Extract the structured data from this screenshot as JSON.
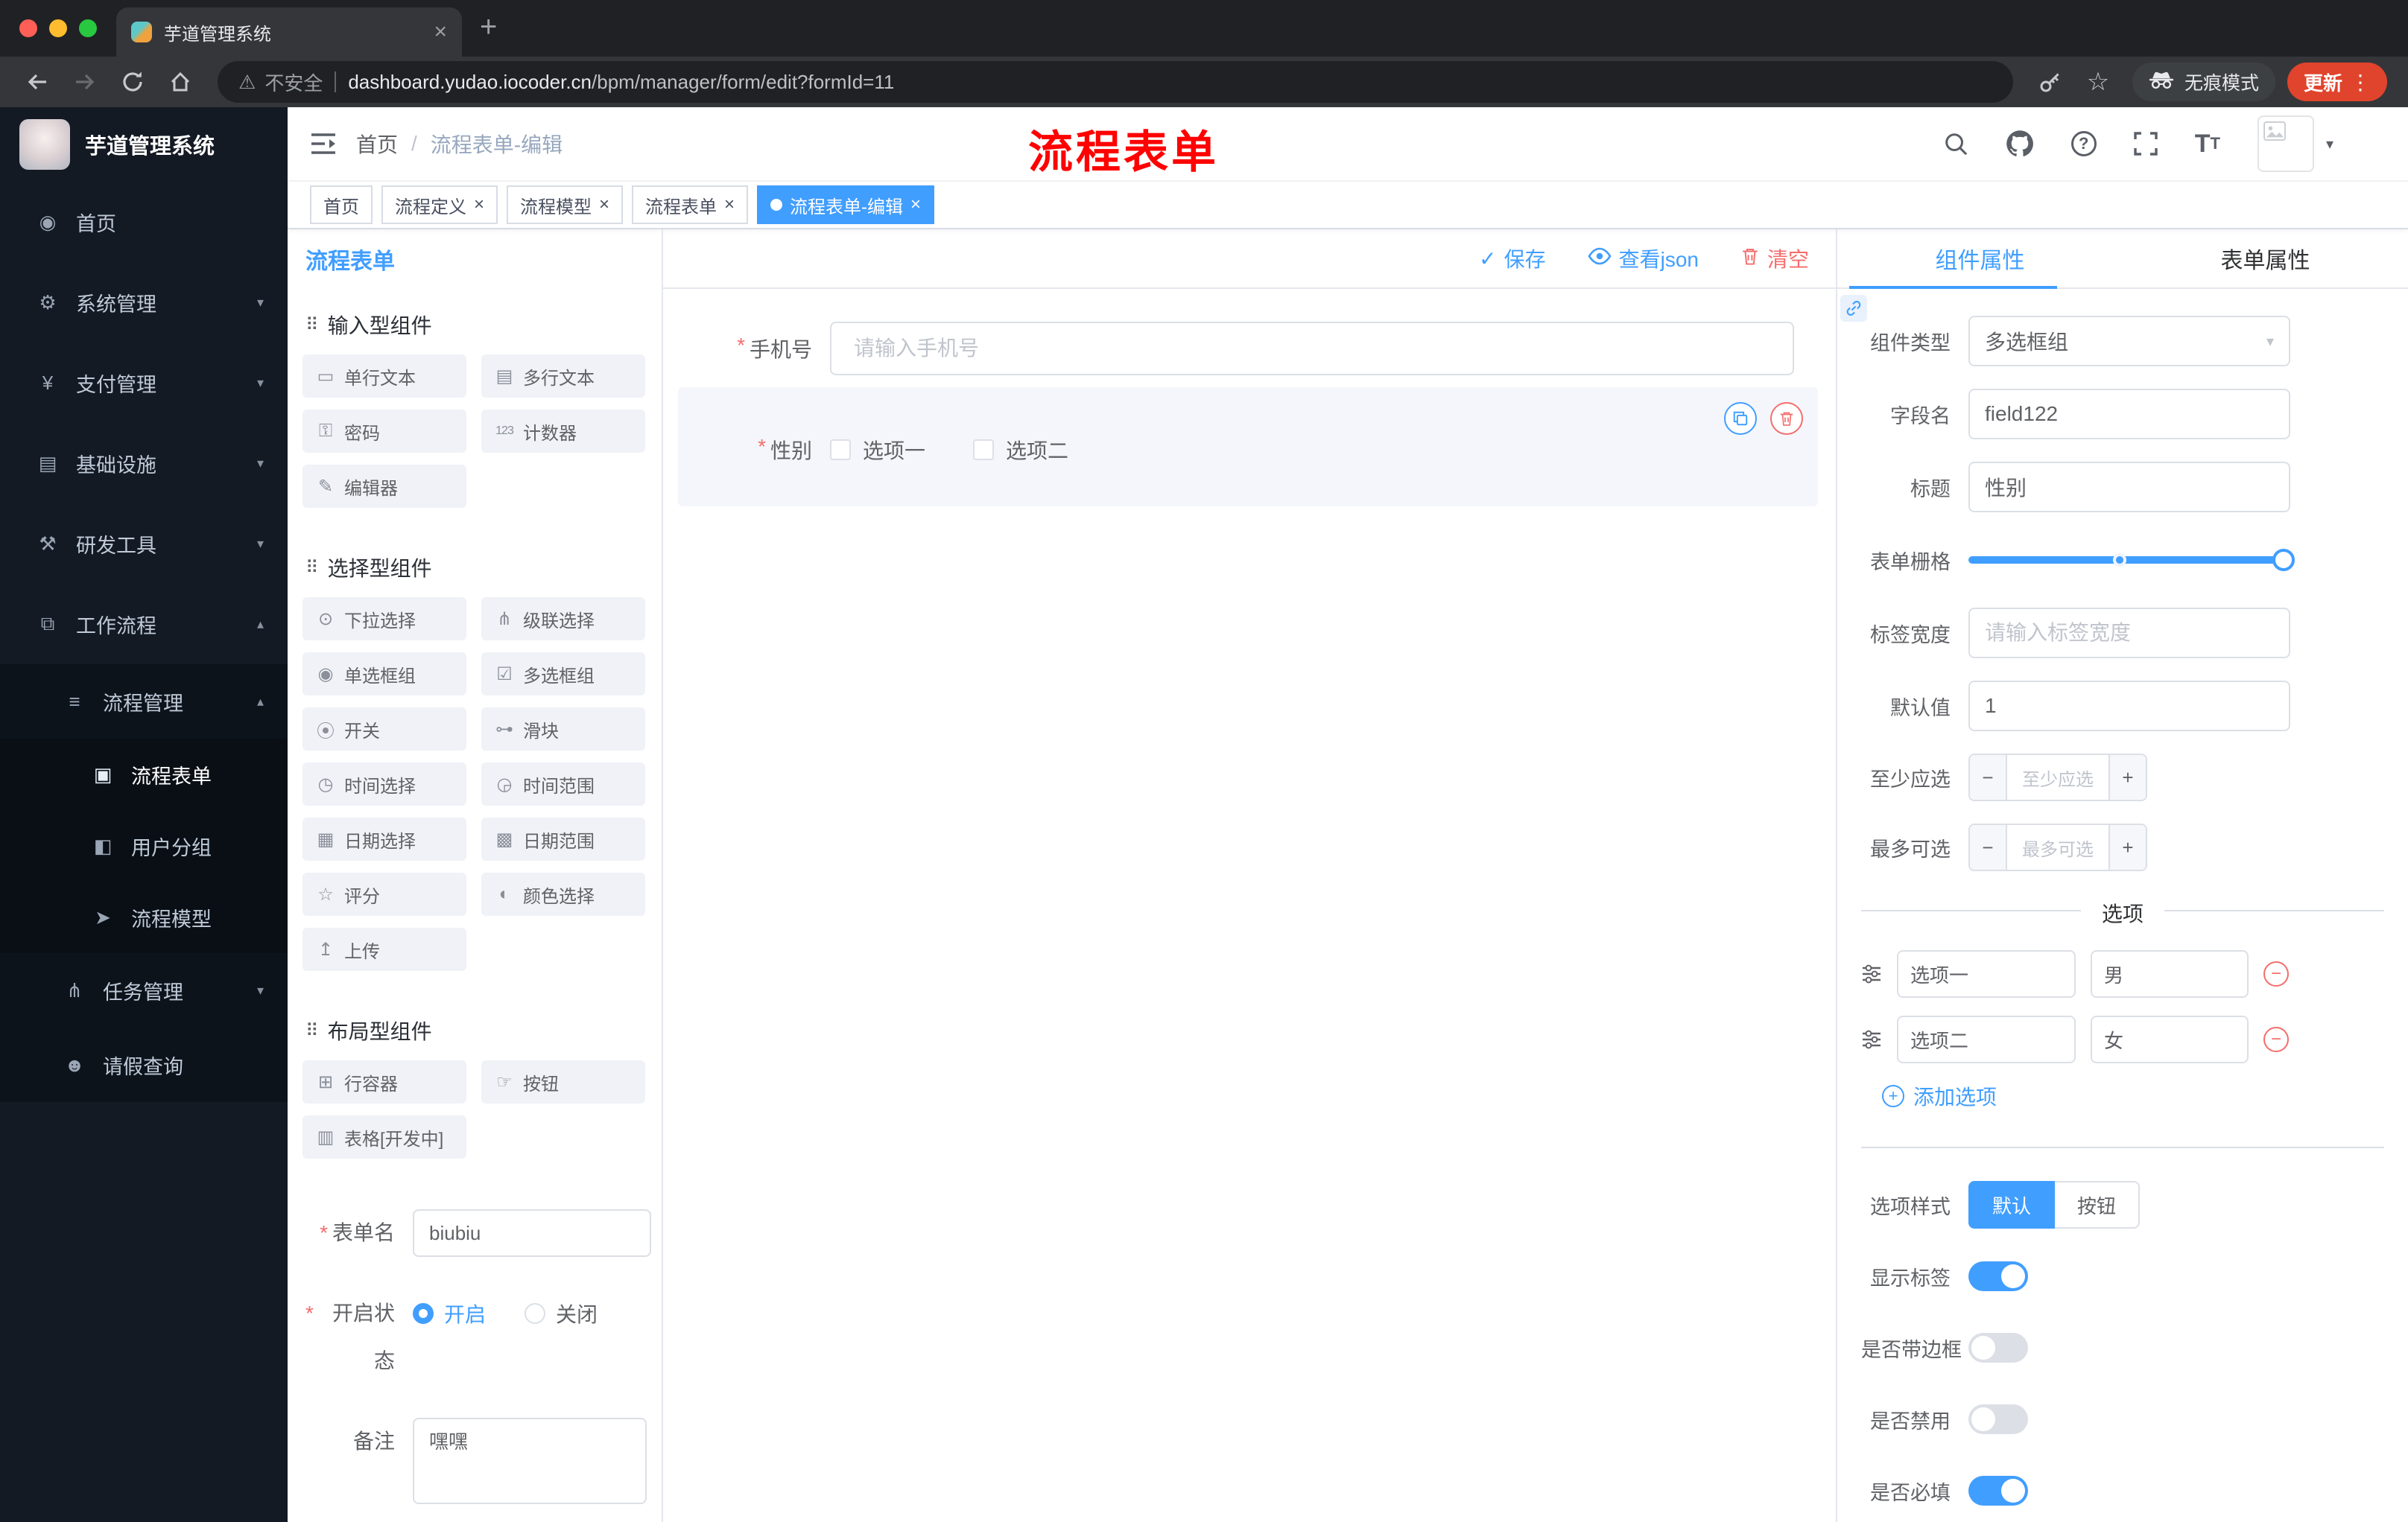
{
  "colors": {
    "accent": "#409eff",
    "danger": "#f56c6c",
    "annotation_red": "#fe0100",
    "sidebar_bg": "#141a23",
    "active_tag": "#409eff"
  },
  "browser": {
    "tab_title": "芋道管理系统",
    "security_label": "不安全",
    "url_host": "dashboard.yudao.iocoder.cn",
    "url_path": "/bpm/manager/form/edit?formId=11",
    "incognito_label": "无痕模式",
    "update_label": "更新"
  },
  "sidebar": {
    "brand": "芋道管理系统",
    "items": [
      "首页",
      "系统管理",
      "支付管理",
      "基础设施",
      "研发工具",
      "工作流程",
      "流程管理",
      "流程表单",
      "用户分组",
      "流程模型",
      "任务管理",
      "请假查询"
    ]
  },
  "navbar": {
    "breadcrumb_home": "首页",
    "breadcrumb_sep": "/",
    "breadcrumb_current": "流程表单-编辑",
    "annotation": "流程表单"
  },
  "tags": {
    "items": [
      "首页",
      "流程定义",
      "流程模型",
      "流程表单",
      "流程表单-编辑"
    ]
  },
  "palette": {
    "title": "流程表单",
    "groups": [
      {
        "title": "输入型组件",
        "items": [
          "单行文本",
          "多行文本",
          "密码",
          "计数器",
          "编辑器"
        ]
      },
      {
        "title": "选择型组件",
        "items": [
          "下拉选择",
          "级联选择",
          "单选框组",
          "多选框组",
          "开关",
          "滑块",
          "时间选择",
          "时间范围",
          "日期选择",
          "日期范围",
          "评分",
          "颜色选择",
          "上传"
        ]
      },
      {
        "title": "布局型组件",
        "items": [
          "行容器",
          "按钮",
          "表格[开发中]"
        ]
      }
    ],
    "form": {
      "name_label": "表单名",
      "name_value": "biubiu",
      "status_label": "开启状态",
      "status_on": "开启",
      "status_off": "关闭",
      "remark_label": "备注",
      "remark_value": "嘿嘿"
    }
  },
  "canvas": {
    "actions": {
      "save": "保存",
      "view_json": "查看json",
      "clear": "清空"
    },
    "phone": {
      "label": "手机号",
      "placeholder": "请输入手机号"
    },
    "gender": {
      "label": "性别",
      "options": [
        "选项一",
        "选项二"
      ]
    }
  },
  "props": {
    "tabs": [
      "组件属性",
      "表单属性"
    ],
    "component_type": {
      "label": "组件类型",
      "value": "多选框组"
    },
    "field_name": {
      "label": "字段名",
      "value": "field122"
    },
    "title": {
      "label": "标题",
      "value": "性别"
    },
    "grid": {
      "label": "表单栅格"
    },
    "label_width": {
      "label": "标签宽度",
      "placeholder": "请输入标签宽度"
    },
    "default_value": {
      "label": "默认值",
      "value": "1"
    },
    "min_select": {
      "label": "至少应选",
      "placeholder": "至少应选"
    },
    "max_select": {
      "label": "最多可选",
      "placeholder": "最多可选"
    },
    "options_title": "选项",
    "options": [
      {
        "label": "选项一",
        "value": "男"
      },
      {
        "label": "选项二",
        "value": "女"
      }
    ],
    "add_option": "添加选项",
    "option_style": {
      "label": "选项样式",
      "choices": [
        "默认",
        "按钮"
      ],
      "selected": "默认"
    },
    "toggles": [
      {
        "label": "显示标签",
        "on": true
      },
      {
        "label": "是否带边框",
        "on": false
      },
      {
        "label": "是否禁用",
        "on": false
      },
      {
        "label": "是否必填",
        "on": true
      }
    ]
  },
  "icons": {
    "dashboard": "◉",
    "gear": "⚙",
    "yen": "¥",
    "infra": "▤",
    "tools": "⚒",
    "workflow": "⧉",
    "list": "≡",
    "doc": "▣",
    "users": "◧",
    "send": "➤",
    "tasks": "⋔",
    "user": "☻",
    "chev_down": "▾",
    "chev_up": "▴",
    "caret": "▾",
    "group": "⠿",
    "text_input": "▭",
    "textarea": "▤",
    "password": "⚿",
    "counter": "123",
    "editor": "✎",
    "select": "⊙",
    "cascader": "⋔",
    "radio": "◉",
    "checkbox": "☑",
    "switch": "⦿",
    "slider": "⊶",
    "time": "◷",
    "time_range": "◶",
    "date": "▦",
    "date_range": "▩",
    "rate": "☆",
    "color": "◐",
    "upload": "↥",
    "row": "⊞",
    "button": "☞",
    "table": "▥",
    "check": "✓",
    "warning": "⚠",
    "star": "☆",
    "dots": "⋮",
    "plus": "+",
    "close": "×",
    "minus": "−",
    "asterisk": "*",
    "question": "?",
    "font_large": "T",
    "font_small": "T"
  }
}
